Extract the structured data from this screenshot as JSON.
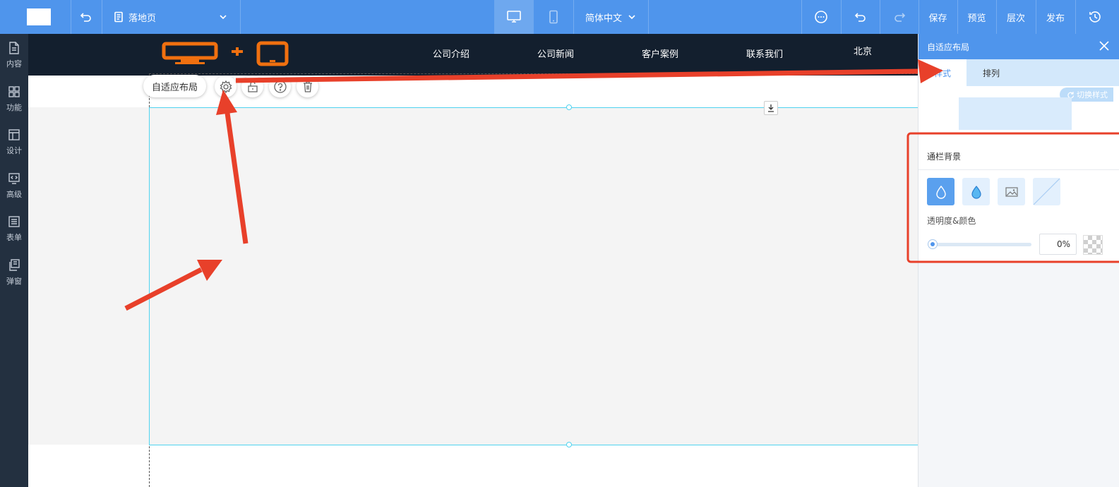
{
  "topbar": {
    "page_name": "落地页",
    "language": "简体中文",
    "save": "保存",
    "preview": "预览",
    "layers": "层次",
    "publish": "发布",
    "accent": "#4f95ec"
  },
  "sidebar": {
    "items": [
      {
        "label": "内容",
        "icon": "document-icon"
      },
      {
        "label": "功能",
        "icon": "grid-icon"
      },
      {
        "label": "设计",
        "icon": "layout-icon"
      },
      {
        "label": "高级",
        "icon": "code-icon"
      },
      {
        "label": "表单",
        "icon": "list-icon"
      },
      {
        "label": "弹窗",
        "icon": "popup-icon"
      }
    ]
  },
  "site": {
    "nav": [
      "公司介绍",
      "公司新闻",
      "客户案例",
      "联系我们",
      "北京"
    ],
    "logo_color": "#f07010",
    "header_color": "#131f2e"
  },
  "toolbar": {
    "label": "自适应布局",
    "icons": [
      "gear-icon",
      "lock-icon",
      "help-icon",
      "trash-icon"
    ]
  },
  "panel": {
    "title": "自适应布局",
    "tabs": [
      "样式",
      "排列"
    ],
    "switch_style": "切换样式",
    "bg_section_label": "通栏背景",
    "alpha_label": "透明度&颜色",
    "opacity": "0%",
    "opacity_value": 0
  },
  "annotations": {
    "arrow_color": "#e8402a"
  }
}
